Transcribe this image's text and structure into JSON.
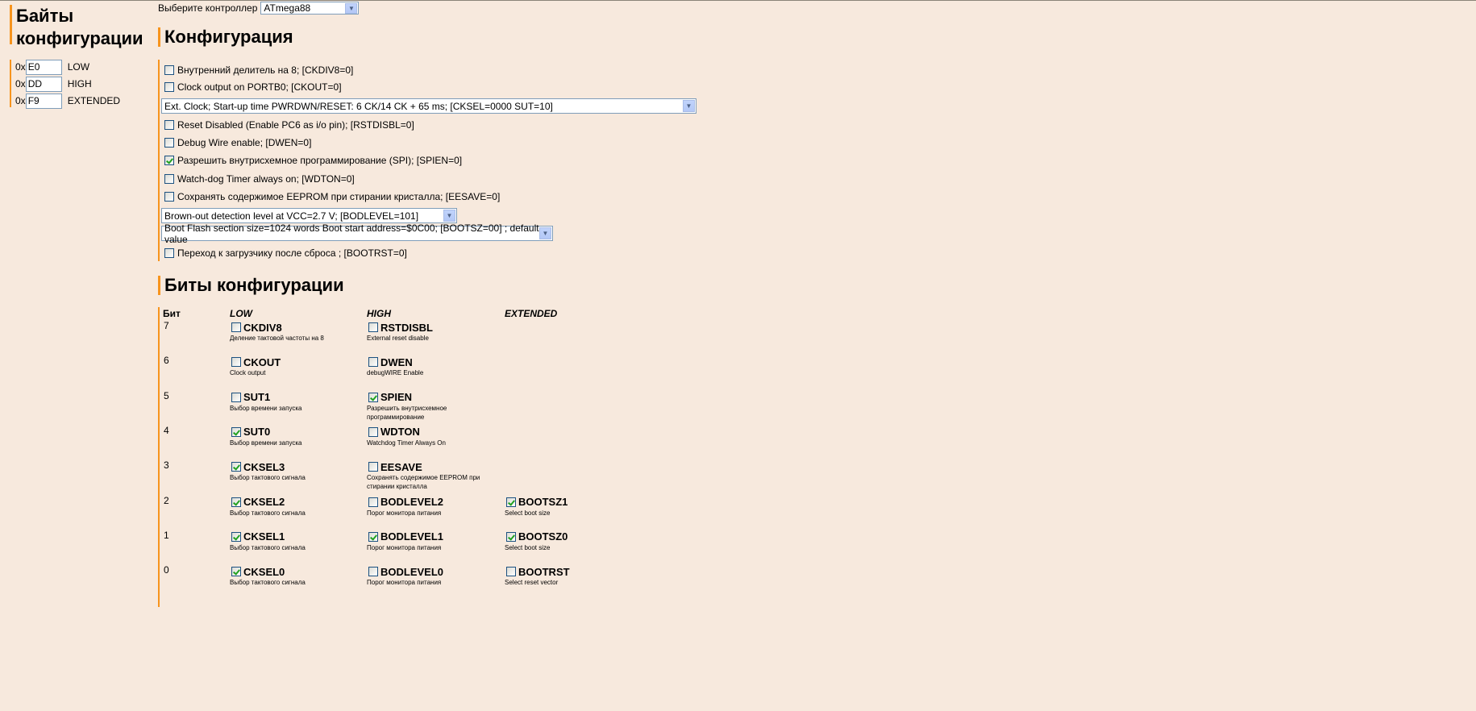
{
  "left": {
    "title": "Байты конфигурации",
    "prefix": "0x",
    "bytes": [
      {
        "value": "E0",
        "label": "LOW"
      },
      {
        "value": "DD",
        "label": "HIGH"
      },
      {
        "value": "F9",
        "label": "EXTENDED"
      }
    ]
  },
  "controller": {
    "label": "Выберите контроллер",
    "value": "ATmega88"
  },
  "config": {
    "title": "Конфигурация",
    "items": [
      {
        "type": "check",
        "checked": false,
        "text": "Внутренний делитель на 8; [CKDIV8=0]"
      },
      {
        "type": "check",
        "checked": false,
        "text": "Clock output on PORTB0; [CKOUT=0]"
      },
      {
        "type": "select",
        "text": "Ext. Clock; Start-up time PWRDWN/RESET: 6 CK/14 CK + 65 ms;  [CKSEL=0000 SUT=10]"
      },
      {
        "type": "check",
        "checked": false,
        "text": "Reset Disabled (Enable PC6 as i/o pin); [RSTDISBL=0]"
      },
      {
        "type": "check",
        "checked": false,
        "text": "Debug Wire enable; [DWEN=0]"
      },
      {
        "type": "check",
        "checked": true,
        "text": "Разрешить внутрисхемное программирование (SPI); [SPIEN=0]"
      },
      {
        "type": "check",
        "checked": false,
        "text": "Watch-dog Timer always on; [WDTON=0]"
      },
      {
        "type": "check",
        "checked": false,
        "text": "Сохранять содержимое EEPROM при стирании кристалла; [EESAVE=0]"
      },
      {
        "type": "select",
        "text": "Brown-out detection level at VCC=2.7 V; [BODLEVEL=101]"
      },
      {
        "type": "select",
        "text": "Boot Flash section size=1024 words Boot start address=$0C00; [BOOTSZ=00] ; default value"
      },
      {
        "type": "check",
        "checked": false,
        "text": "Переход к загрузчику после сброса ; [BOOTRST=0]"
      }
    ]
  },
  "bits": {
    "title": "Биты конфигурации",
    "headers": [
      "Бит",
      "LOW",
      "HIGH",
      "EXTENDED"
    ],
    "rows": [
      {
        "bit": "7",
        "low": {
          "name": "CKDIV8",
          "checked": false,
          "desc": "Деление тактовой частоты на 8"
        },
        "high": {
          "name": "RSTDISBL",
          "checked": false,
          "desc": "External reset disable"
        }
      },
      {
        "bit": "6",
        "low": {
          "name": "CKOUT",
          "checked": false,
          "desc": "Clock output"
        },
        "high": {
          "name": "DWEN",
          "checked": false,
          "desc": "debugWIRE Enable"
        }
      },
      {
        "bit": "5",
        "low": {
          "name": "SUT1",
          "checked": false,
          "desc": "Выбор времени запуска"
        },
        "high": {
          "name": "SPIEN",
          "checked": true,
          "desc": "Разрешить внутрисхемное программирование"
        }
      },
      {
        "bit": "4",
        "low": {
          "name": "SUT0",
          "checked": true,
          "desc": "Выбор времени запуска"
        },
        "high": {
          "name": "WDTON",
          "checked": false,
          "desc": "Watchdog Timer Always On"
        }
      },
      {
        "bit": "3",
        "low": {
          "name": "CKSEL3",
          "checked": true,
          "desc": "Выбор тактового сигнала"
        },
        "high": {
          "name": "EESAVE",
          "checked": false,
          "desc": "Сохранять содержимое EEPROM при стирании кристалла"
        }
      },
      {
        "bit": "2",
        "low": {
          "name": "CKSEL2",
          "checked": true,
          "desc": "Выбор тактового сигнала"
        },
        "high": {
          "name": "BODLEVEL2",
          "checked": false,
          "desc": "Порог монитора питания"
        },
        "ext": {
          "name": "BOOTSZ1",
          "checked": true,
          "desc": "Select boot size"
        }
      },
      {
        "bit": "1",
        "low": {
          "name": "CKSEL1",
          "checked": true,
          "desc": "Выбор тактового сигнала"
        },
        "high": {
          "name": "BODLEVEL1",
          "checked": true,
          "desc": "Порог монитора питания"
        },
        "ext": {
          "name": "BOOTSZ0",
          "checked": true,
          "desc": "Select boot size"
        }
      },
      {
        "bit": "0",
        "low": {
          "name": "CKSEL0",
          "checked": true,
          "desc": "Выбор тактового сигнала"
        },
        "high": {
          "name": "BODLEVEL0",
          "checked": false,
          "desc": "Порог монитора питания"
        },
        "ext": {
          "name": "BOOTRST",
          "checked": false,
          "desc": "Select reset vector"
        }
      }
    ]
  }
}
